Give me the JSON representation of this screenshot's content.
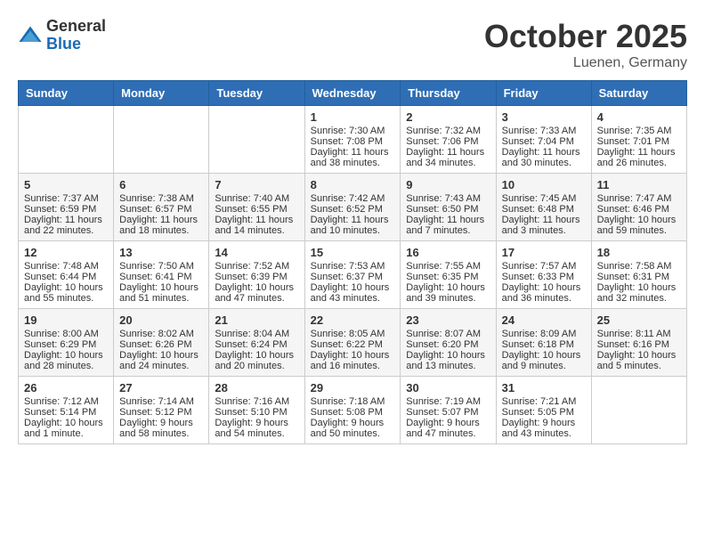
{
  "header": {
    "logo_general": "General",
    "logo_blue": "Blue",
    "month_title": "October 2025",
    "location": "Luenen, Germany"
  },
  "calendar": {
    "days_of_week": [
      "Sunday",
      "Monday",
      "Tuesday",
      "Wednesday",
      "Thursday",
      "Friday",
      "Saturday"
    ],
    "weeks": [
      [
        {
          "day": "",
          "content": ""
        },
        {
          "day": "",
          "content": ""
        },
        {
          "day": "",
          "content": ""
        },
        {
          "day": "1",
          "content": "Sunrise: 7:30 AM\nSunset: 7:08 PM\nDaylight: 11 hours\nand 38 minutes."
        },
        {
          "day": "2",
          "content": "Sunrise: 7:32 AM\nSunset: 7:06 PM\nDaylight: 11 hours\nand 34 minutes."
        },
        {
          "day": "3",
          "content": "Sunrise: 7:33 AM\nSunset: 7:04 PM\nDaylight: 11 hours\nand 30 minutes."
        },
        {
          "day": "4",
          "content": "Sunrise: 7:35 AM\nSunset: 7:01 PM\nDaylight: 11 hours\nand 26 minutes."
        }
      ],
      [
        {
          "day": "5",
          "content": "Sunrise: 7:37 AM\nSunset: 6:59 PM\nDaylight: 11 hours\nand 22 minutes."
        },
        {
          "day": "6",
          "content": "Sunrise: 7:38 AM\nSunset: 6:57 PM\nDaylight: 11 hours\nand 18 minutes."
        },
        {
          "day": "7",
          "content": "Sunrise: 7:40 AM\nSunset: 6:55 PM\nDaylight: 11 hours\nand 14 minutes."
        },
        {
          "day": "8",
          "content": "Sunrise: 7:42 AM\nSunset: 6:52 PM\nDaylight: 11 hours\nand 10 minutes."
        },
        {
          "day": "9",
          "content": "Sunrise: 7:43 AM\nSunset: 6:50 PM\nDaylight: 11 hours\nand 7 minutes."
        },
        {
          "day": "10",
          "content": "Sunrise: 7:45 AM\nSunset: 6:48 PM\nDaylight: 11 hours\nand 3 minutes."
        },
        {
          "day": "11",
          "content": "Sunrise: 7:47 AM\nSunset: 6:46 PM\nDaylight: 10 hours\nand 59 minutes."
        }
      ],
      [
        {
          "day": "12",
          "content": "Sunrise: 7:48 AM\nSunset: 6:44 PM\nDaylight: 10 hours\nand 55 minutes."
        },
        {
          "day": "13",
          "content": "Sunrise: 7:50 AM\nSunset: 6:41 PM\nDaylight: 10 hours\nand 51 minutes."
        },
        {
          "day": "14",
          "content": "Sunrise: 7:52 AM\nSunset: 6:39 PM\nDaylight: 10 hours\nand 47 minutes."
        },
        {
          "day": "15",
          "content": "Sunrise: 7:53 AM\nSunset: 6:37 PM\nDaylight: 10 hours\nand 43 minutes."
        },
        {
          "day": "16",
          "content": "Sunrise: 7:55 AM\nSunset: 6:35 PM\nDaylight: 10 hours\nand 39 minutes."
        },
        {
          "day": "17",
          "content": "Sunrise: 7:57 AM\nSunset: 6:33 PM\nDaylight: 10 hours\nand 36 minutes."
        },
        {
          "day": "18",
          "content": "Sunrise: 7:58 AM\nSunset: 6:31 PM\nDaylight: 10 hours\nand 32 minutes."
        }
      ],
      [
        {
          "day": "19",
          "content": "Sunrise: 8:00 AM\nSunset: 6:29 PM\nDaylight: 10 hours\nand 28 minutes."
        },
        {
          "day": "20",
          "content": "Sunrise: 8:02 AM\nSunset: 6:26 PM\nDaylight: 10 hours\nand 24 minutes."
        },
        {
          "day": "21",
          "content": "Sunrise: 8:04 AM\nSunset: 6:24 PM\nDaylight: 10 hours\nand 20 minutes."
        },
        {
          "day": "22",
          "content": "Sunrise: 8:05 AM\nSunset: 6:22 PM\nDaylight: 10 hours\nand 16 minutes."
        },
        {
          "day": "23",
          "content": "Sunrise: 8:07 AM\nSunset: 6:20 PM\nDaylight: 10 hours\nand 13 minutes."
        },
        {
          "day": "24",
          "content": "Sunrise: 8:09 AM\nSunset: 6:18 PM\nDaylight: 10 hours\nand 9 minutes."
        },
        {
          "day": "25",
          "content": "Sunrise: 8:11 AM\nSunset: 6:16 PM\nDaylight: 10 hours\nand 5 minutes."
        }
      ],
      [
        {
          "day": "26",
          "content": "Sunrise: 7:12 AM\nSunset: 5:14 PM\nDaylight: 10 hours\nand 1 minute."
        },
        {
          "day": "27",
          "content": "Sunrise: 7:14 AM\nSunset: 5:12 PM\nDaylight: 9 hours\nand 58 minutes."
        },
        {
          "day": "28",
          "content": "Sunrise: 7:16 AM\nSunset: 5:10 PM\nDaylight: 9 hours\nand 54 minutes."
        },
        {
          "day": "29",
          "content": "Sunrise: 7:18 AM\nSunset: 5:08 PM\nDaylight: 9 hours\nand 50 minutes."
        },
        {
          "day": "30",
          "content": "Sunrise: 7:19 AM\nSunset: 5:07 PM\nDaylight: 9 hours\nand 47 minutes."
        },
        {
          "day": "31",
          "content": "Sunrise: 7:21 AM\nSunset: 5:05 PM\nDaylight: 9 hours\nand 43 minutes."
        },
        {
          "day": "",
          "content": ""
        }
      ]
    ]
  }
}
